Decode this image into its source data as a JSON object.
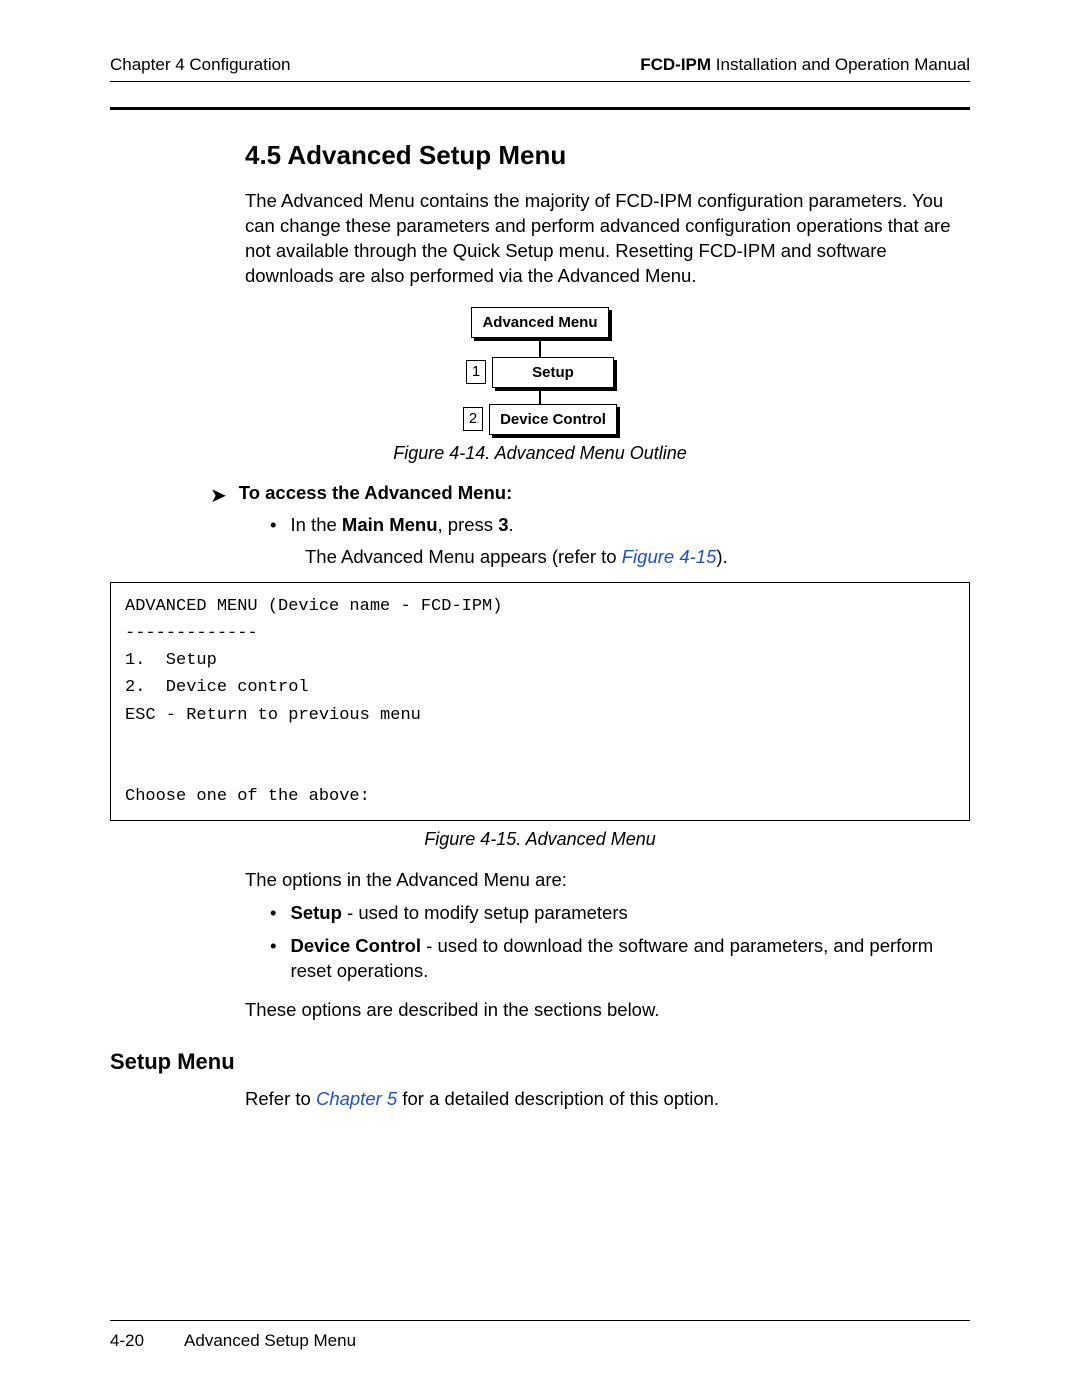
{
  "header": {
    "left": "Chapter 4  Configuration",
    "right_bold": "FCD-IPM",
    "right_rest": " Installation and Operation Manual"
  },
  "section": {
    "number_title": "4.5  Advanced Setup Menu",
    "intro": "The Advanced Menu contains the majority of FCD-IPM configuration parameters. You can change these parameters and perform advanced configuration operations that are not available through the Quick Setup menu. Resetting FCD-IPM and software downloads are also performed via the Advanced Menu."
  },
  "diagram": {
    "top": "Advanced Menu",
    "nodes": [
      {
        "num": "1",
        "label": "Setup"
      },
      {
        "num": "2",
        "label": "Device Control"
      }
    ]
  },
  "fig14_caption": "Figure 4-14.  Advanced Menu Outline",
  "access": {
    "heading": "To access the Advanced Menu:",
    "bullet_pre": "In the ",
    "bullet_bold": "Main Menu",
    "bullet_mid": ", press ",
    "bullet_key": "3",
    "bullet_post": ".",
    "result_pre": "The Advanced Menu appears (refer to ",
    "result_link": "Figure 4-15",
    "result_post": ")."
  },
  "terminal": "ADVANCED MENU (Device name - FCD-IPM)\n-------------\n1.  Setup\n2.  Device control\nESC - Return to previous menu\n\n\nChoose one of the above:",
  "fig15_caption": "Figure 4-15.  Advanced Menu",
  "options_intro": "The options in the Advanced Menu are:",
  "options": [
    {
      "bold": "Setup",
      "rest": " - used to modify setup parameters"
    },
    {
      "bold": "Device Control",
      "rest": " - used to download the software and parameters, and perform reset operations."
    }
  ],
  "options_outro": "These options are described in the sections below.",
  "setup_menu": {
    "heading": "Setup Menu",
    "line_pre": "Refer to ",
    "line_link": "Chapter 5",
    "line_post": " for a detailed description of this option."
  },
  "footer": {
    "page": "4-20",
    "title": "Advanced Setup Menu"
  }
}
